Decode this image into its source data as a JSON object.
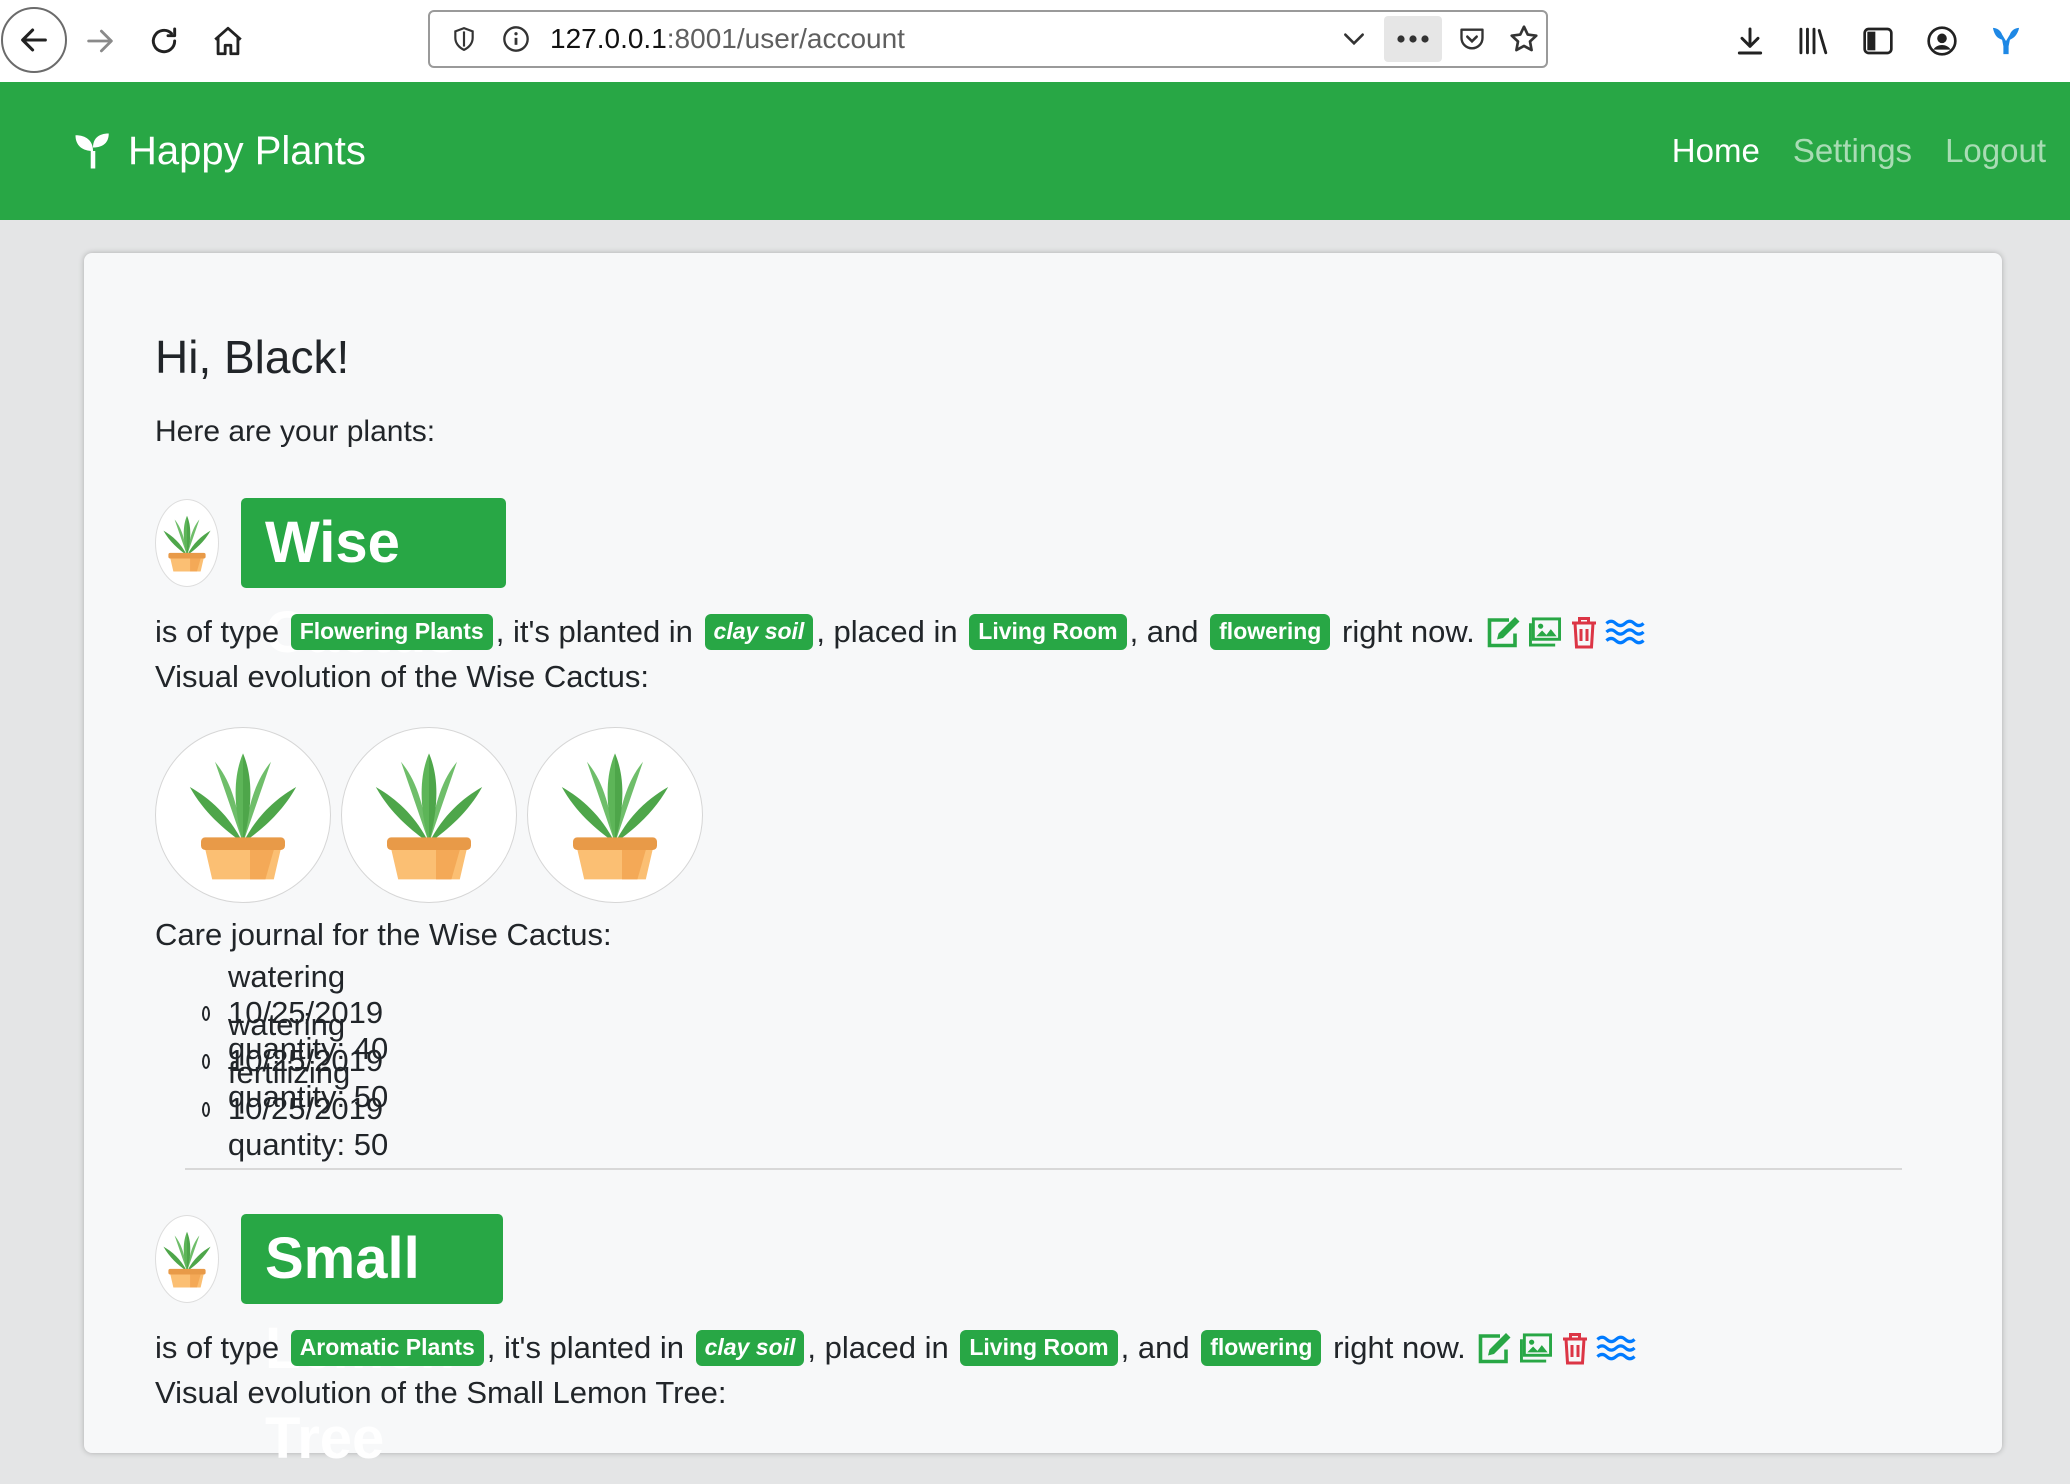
{
  "browser": {
    "url_host": "127.0.0.1",
    "url_path": ":8001/user/account"
  },
  "navbar": {
    "brand": "Happy Plants",
    "links": [
      {
        "label": "Home",
        "active": true
      },
      {
        "label": "Settings",
        "active": false
      },
      {
        "label": "Logout",
        "active": false
      }
    ]
  },
  "page": {
    "greeting": "Hi, Black!",
    "intro": "Here are your plants:"
  },
  "plants": [
    {
      "name": "Wise Cactus",
      "prefix": "is of type",
      "type": "Flowering Plants",
      "planted_text": ", it's planted in",
      "soil": "clay soil",
      "placed_text": ", placed in",
      "location": "Living Room",
      "and_text": ", and",
      "state": "flowering",
      "suffix": "right now.",
      "evolution_label": "Visual evolution of the Wise Cactus:",
      "journal_label": "Care journal for the Wise Cactus:",
      "journal": [
        "watering 10/25/2019 quantity: 40",
        "watering 10/25/2019 quantity: 50",
        "fertilizing 10/25/2019 quantity: 50"
      ]
    },
    {
      "name": "Small Lemon Tree",
      "prefix": "is of type",
      "type": "Aromatic Plants",
      "planted_text": ", it's planted in",
      "soil": "clay soil",
      "placed_text": ", placed in",
      "location": "Living Room",
      "and_text": ", and",
      "state": "flowering",
      "suffix": "right now.",
      "evolution_label": "Visual evolution of the Small Lemon Tree:"
    }
  ],
  "colors": {
    "brand_green": "#28a745",
    "edit_icon": "#28a745",
    "gallery_icon": "#28a745",
    "delete_icon": "#dc3545",
    "water_icon": "#007bff"
  }
}
